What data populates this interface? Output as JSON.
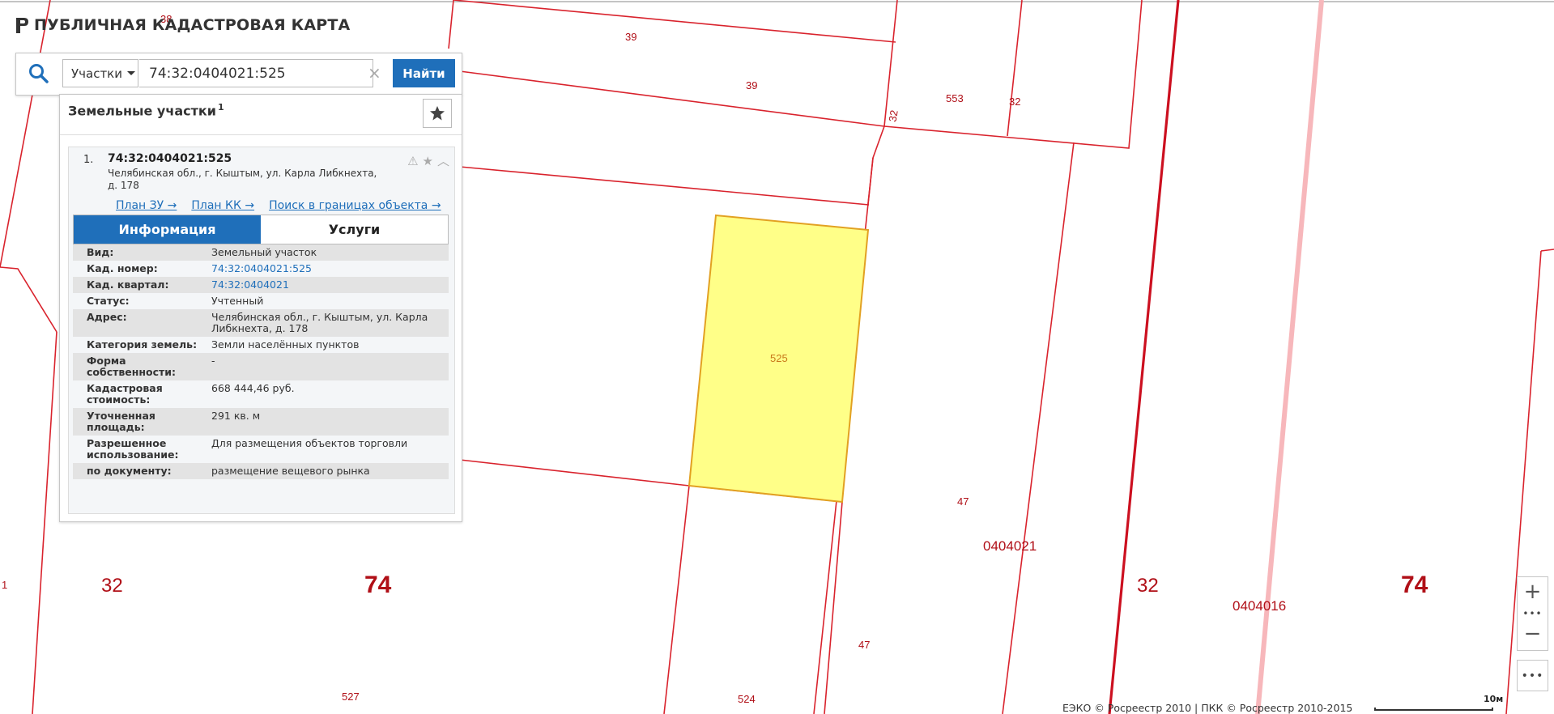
{
  "app": {
    "title": "ПУБЛИЧНАЯ КАДАСТРОВАЯ КАРТА"
  },
  "search": {
    "type_label": "Участки",
    "query": "74:32:0404021:525",
    "find_label": "Найти",
    "clear_symbol": "×"
  },
  "results": {
    "header": "Земельные участки",
    "count": "1",
    "items": [
      {
        "index": "1.",
        "title": "74:32:0404021:525",
        "address": "Челябинская обл., г. Кыштым, ул. Карла Либкнехта, д. 178",
        "links": [
          "План ЗУ →",
          "План КК →",
          "Поиск в границах объекта →"
        ],
        "tabs": [
          "Информация",
          "Услуги"
        ],
        "attributes": [
          {
            "key": "Вид:",
            "value": "Земельный участок"
          },
          {
            "key": "Кад. номер:",
            "value": "74:32:0404021:525"
          },
          {
            "key": "Кад. квартал:",
            "value": "74:32:0404021"
          },
          {
            "key": "Статус:",
            "value": "Учтенный"
          },
          {
            "key": "Адрес:",
            "value": "Челябинская обл., г. Кыштым, ул. Карла Либкнехта, д. 178"
          },
          {
            "key": "Категория земель:",
            "value": "Земли населённых пунктов"
          },
          {
            "key": "Форма собственности:",
            "value": "-"
          },
          {
            "key": "Кадастровая стоимость:",
            "value": "668 444,46 руб."
          },
          {
            "key": "Уточненная площадь:",
            "value": "291 кв. м"
          },
          {
            "key": "Разрешенное использование:",
            "value": "Для размещения объектов торговли"
          },
          {
            "key": "по документу:",
            "value": "размещение вещевого рынка"
          }
        ]
      }
    ]
  },
  "map": {
    "labels": {
      "l38": "38",
      "l39a": "39",
      "l39b": "39",
      "l32a": "32",
      "l553": "553",
      "l32b": "32",
      "l525": "525",
      "l47a": "47",
      "l0404021": "0404021",
      "l1": "1",
      "l32c": "32",
      "l74a": "74",
      "l32d": "32",
      "l0404016": "0404016",
      "l74b": "74",
      "l47b": "47",
      "l527": "527",
      "l524": "524"
    },
    "colors": {
      "boundary": "#d9232d",
      "selected_fill": "#ffff88",
      "selected_stroke": "#e0a020",
      "label": "#b00f17"
    }
  },
  "controls": {
    "zoom_in": "+",
    "zoom_out": "−",
    "dots": "•••",
    "more": "•••"
  },
  "footer": {
    "attribution": "ЕЭКО © Росреестр 2010 | ПКК © Росреестр 2010-2015",
    "scale_label": "10м"
  }
}
